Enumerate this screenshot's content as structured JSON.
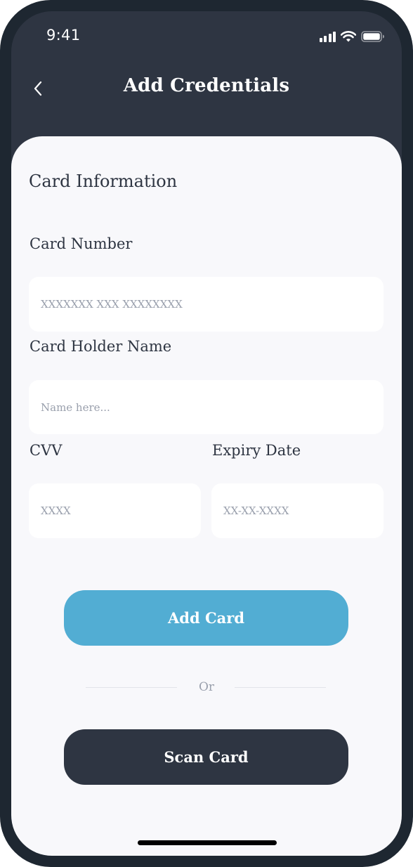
{
  "status_bar": {
    "time": "9:41",
    "icons": [
      "signal-icon",
      "wifi-icon",
      "battery-icon"
    ]
  },
  "header": {
    "back_icon": "chevron-left-icon",
    "title": "Add Credentials"
  },
  "form": {
    "section_title": "Card Information",
    "card_number": {
      "label": "Card Number",
      "placeholder": "XXXXXXX XXX XXXXXXXX",
      "value": ""
    },
    "card_holder": {
      "label": "Card Holder Name",
      "placeholder": "Name here...",
      "value": ""
    },
    "cvv": {
      "label": "CVV",
      "placeholder": "XXXX",
      "value": ""
    },
    "expiry": {
      "label": "Expiry Date",
      "placeholder": "XX-XX-XXXX",
      "value": ""
    }
  },
  "actions": {
    "add_card_label": "Add Card",
    "or_label": "Or",
    "scan_card_label": "Scan Card"
  },
  "colors": {
    "header_bg": "#2e3542",
    "sheet_bg": "#f8f8fb",
    "primary_button": "#52add3",
    "secondary_button": "#2e3542"
  }
}
